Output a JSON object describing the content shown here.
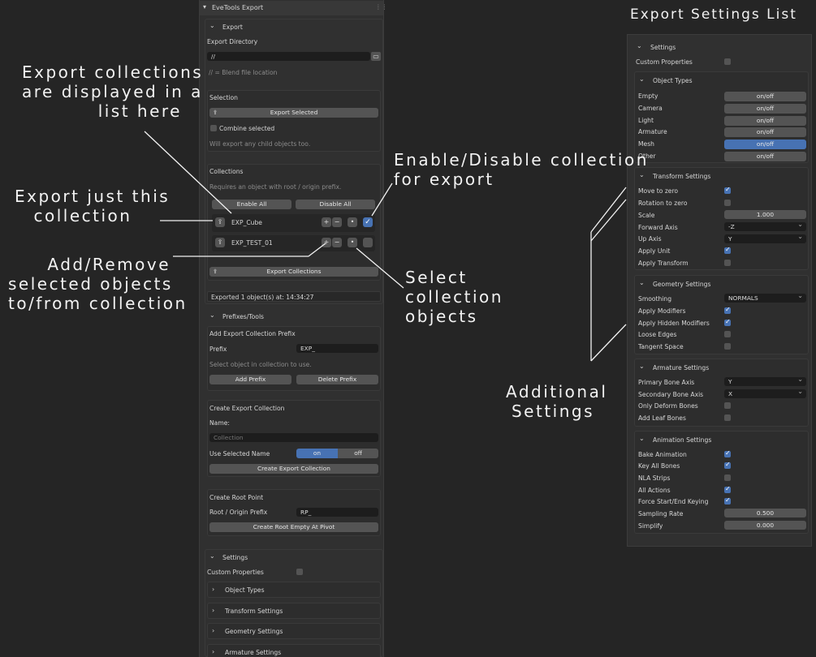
{
  "panel": {
    "title": "EveTools Export",
    "export": {
      "header": "Export",
      "dir_label": "Export Directory",
      "dir_value": "//",
      "dir_hint": "// = Blend file location",
      "selection_title": "Selection",
      "export_selected": "Export Selected",
      "combine_label": "Combine selected",
      "child_hint": "Will export any child objects too.",
      "collections_title": "Collections",
      "collections_hint": "Requires an object with root / origin prefix.",
      "enable_all": "Enable All",
      "disable_all": "Disable All",
      "collections": [
        {
          "name": "EXP_Cube",
          "enabled": true
        },
        {
          "name": "EXP_TEST_01",
          "enabled": false
        }
      ],
      "plus": "+",
      "minus": "−",
      "dot": "•",
      "export_collections": "Export Collections",
      "status": "Exported 1 object(s) at:  14:34:27"
    },
    "prefixes": {
      "header": "Prefixes/Tools",
      "add_title": "Add Export Collection Prefix",
      "prefix_label": "Prefix",
      "prefix_value": "EXP_",
      "select_hint": "Select object in collection to use.",
      "add_prefix": "Add Prefix",
      "delete_prefix": "Delete Prefix",
      "create_title": "Create Export Collection",
      "name_label": "Name:",
      "name_placeholder": "Collection",
      "use_selected_label": "Use Selected Name",
      "toggle_on": "on",
      "toggle_off": "off",
      "create_button": "Create Export Collection",
      "root_title": "Create Root Point",
      "root_label": "Root / Origin Prefix",
      "root_value": "RP_",
      "root_button": "Create Root Empty At Pivot"
    },
    "settings": {
      "header": "Settings",
      "custom_props": "Custom Properties",
      "subs": [
        "Object Types",
        "Transform Settings",
        "Geometry Settings",
        "Armature Settings"
      ]
    }
  },
  "right": {
    "title": "Export Settings List",
    "header": "Settings",
    "custom_props": "Custom Properties",
    "object_types": {
      "header": "Object Types",
      "toggle_text": "on/off",
      "items": [
        {
          "label": "Empty",
          "active": false
        },
        {
          "label": "Camera",
          "active": false
        },
        {
          "label": "Light",
          "active": false
        },
        {
          "label": "Armature",
          "active": false
        },
        {
          "label": "Mesh",
          "active": true
        },
        {
          "label": "Other",
          "active": false
        }
      ]
    },
    "transform": {
      "header": "Transform Settings",
      "move_to_zero": "Move to zero",
      "rotation_to_zero": "Rotation to zero",
      "scale_label": "Scale",
      "scale_value": "1.000",
      "forward_label": "Forward Axis",
      "forward_value": "-Z",
      "up_label": "Up Axis",
      "up_value": "Y",
      "apply_unit": "Apply Unit",
      "apply_transform": "Apply Transform"
    },
    "geometry": {
      "header": "Geometry Settings",
      "smoothing_label": "Smoothing",
      "smoothing_value": "NORMALS",
      "apply_modifiers": "Apply Modifiers",
      "apply_hidden": "Apply Hidden Modifiers",
      "loose_edges": "Loose Edges",
      "tangent_space": "Tangent Space"
    },
    "armature": {
      "header": "Armature Settings",
      "primary_label": "Primary Bone Axis",
      "primary_value": "Y",
      "secondary_label": "Secondary Bone Axis",
      "secondary_value": "X",
      "only_deform": "Only Deform Bones",
      "add_leaf": "Add Leaf Bones"
    },
    "animation": {
      "header": "Animation Settings",
      "bake": "Bake Animation",
      "key_all": "Key All Bones",
      "nla": "NLA Strips",
      "all_actions": "All Actions",
      "force_keying": "Force Start/End Keying",
      "sampling_label": "Sampling Rate",
      "sampling_value": "0.500",
      "simplify_label": "Simplify",
      "simplify_value": "0.000"
    }
  },
  "annotations": {
    "a1": [
      "Export collections",
      "are displayed in a",
      "list here"
    ],
    "a2": [
      "Export just this",
      "collection"
    ],
    "a3": [
      "Add/Remove",
      "selected objects",
      "to/from collection"
    ],
    "a4": [
      "Enable/Disable collection",
      "for export"
    ],
    "a5": [
      "Select",
      "collection",
      "objects"
    ],
    "a6": [
      "Additional",
      "Settings"
    ]
  }
}
